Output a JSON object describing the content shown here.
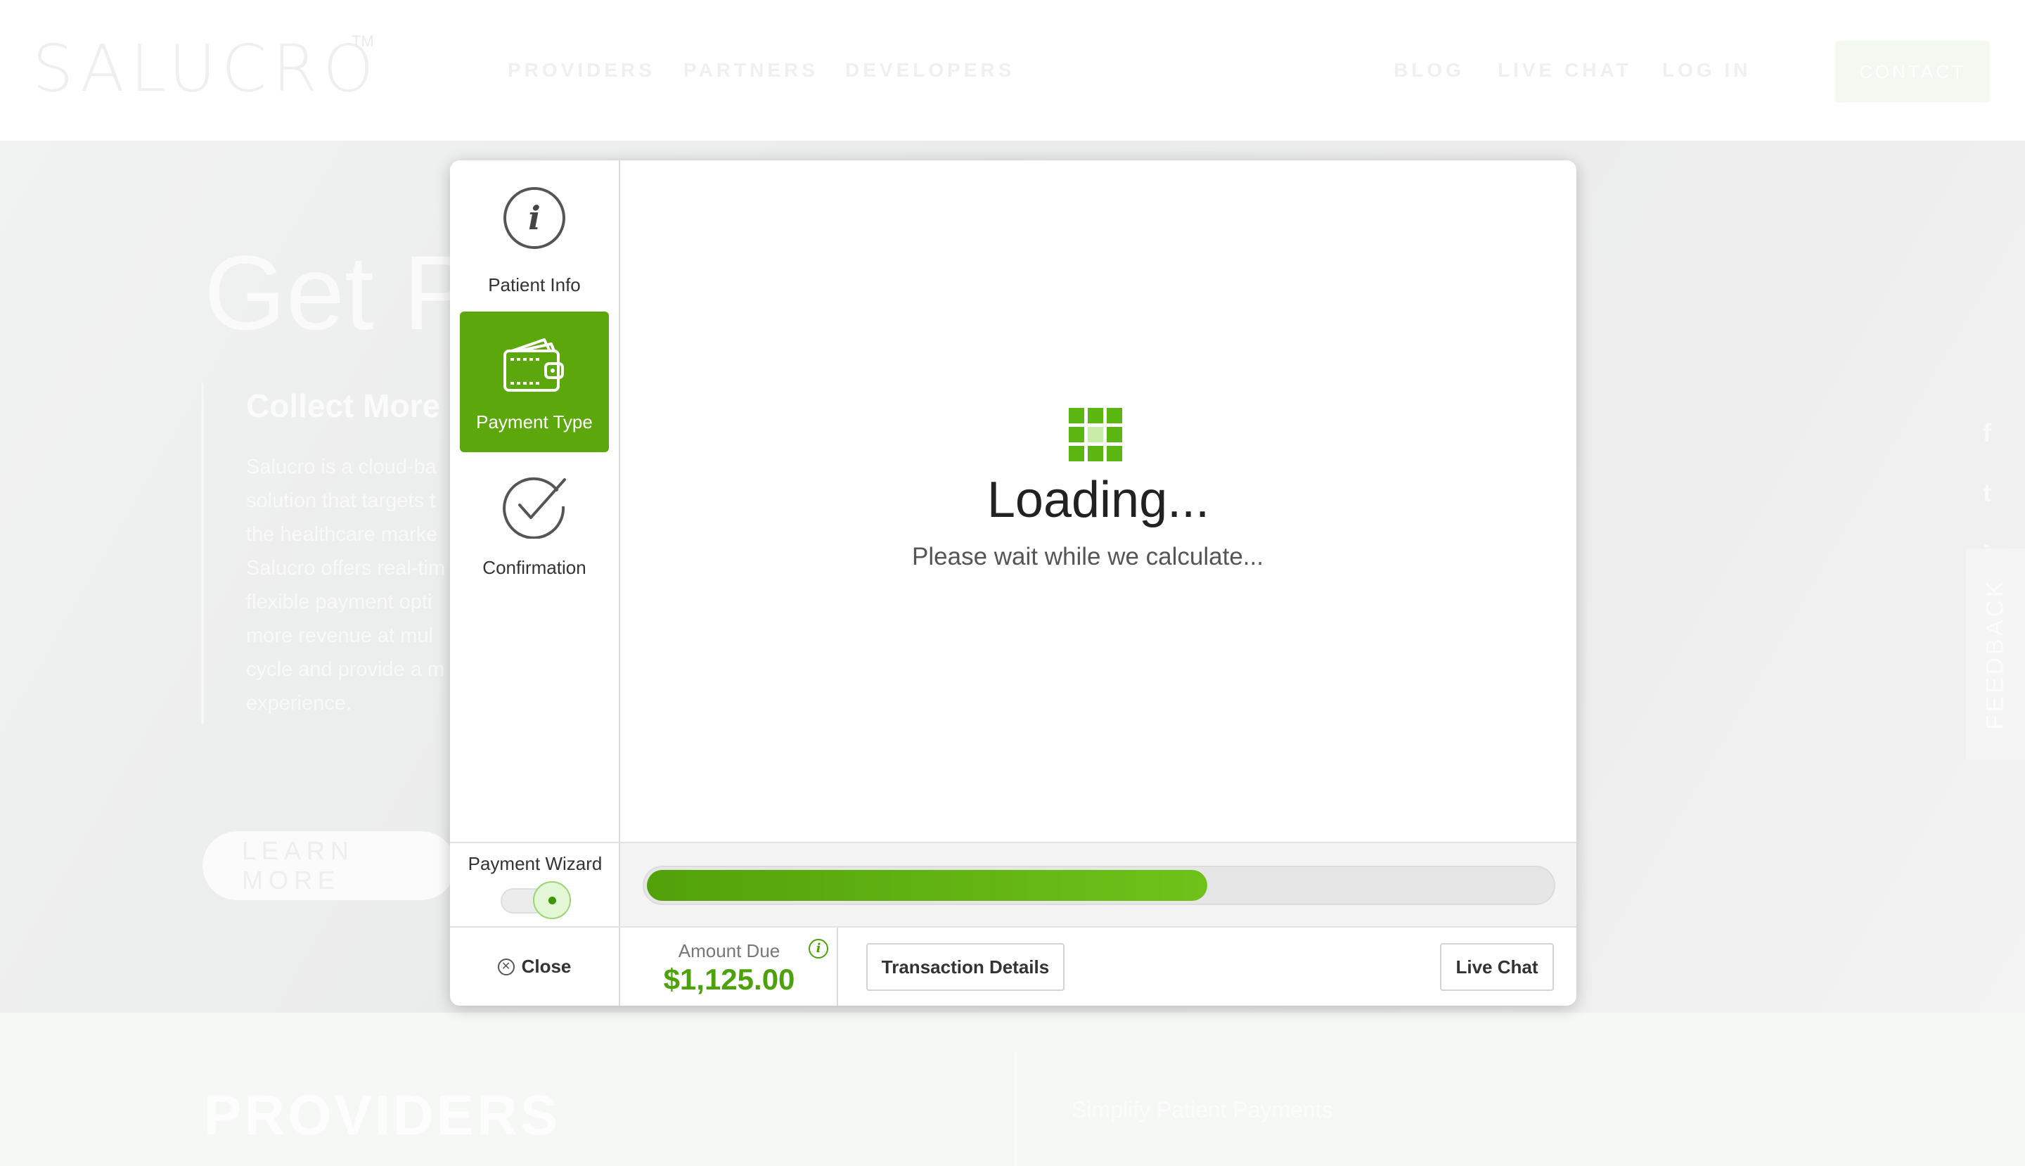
{
  "site": {
    "logo": "SALUCRO",
    "logo_tm": "TM",
    "nav": [
      "PROVIDERS",
      "PARTNERS",
      "DEVELOPERS"
    ],
    "nav_right": [
      "BLOG",
      "LIVE CHAT",
      "LOG IN"
    ],
    "contact": "CONTACT",
    "hero_title": "Get Pa",
    "hero_subtitle": "Collect More",
    "hero_paragraph": "Salucro is a cloud-ba\nsolution that targets t\nthe healthcare marke\nSalucro offers real-tim\nflexible payment opti\nmore revenue at mul\ncycle and provide a m\nexperience.",
    "learn_more": "LEARN MORE",
    "social_icons": [
      "facebook-icon",
      "twitter-icon",
      "linkedin-icon"
    ],
    "feedback": "FEEDBACK",
    "section_title": "PROVIDERS",
    "section_sub": "Simplify Patient Payments"
  },
  "wizard": {
    "steps": [
      {
        "label": "Patient Info",
        "icon": "info-icon",
        "active": false
      },
      {
        "label": "Payment Type",
        "icon": "wallet-icon",
        "active": true
      },
      {
        "label": "Confirmation",
        "icon": "checkmark-icon",
        "active": false
      }
    ],
    "loading_title": "Loading...",
    "loading_subtitle": "Please wait while we calculate...",
    "toggle_label": "Payment Wizard",
    "toggle_on": true,
    "progress": 0.62,
    "close_label": "Close",
    "amount_label": "Amount Due",
    "amount_value": "$1,125.00",
    "transaction_details": "Transaction Details",
    "live_chat": "Live Chat"
  },
  "colors": {
    "accent": "#5ba70c",
    "amount": "#4ca20b"
  }
}
